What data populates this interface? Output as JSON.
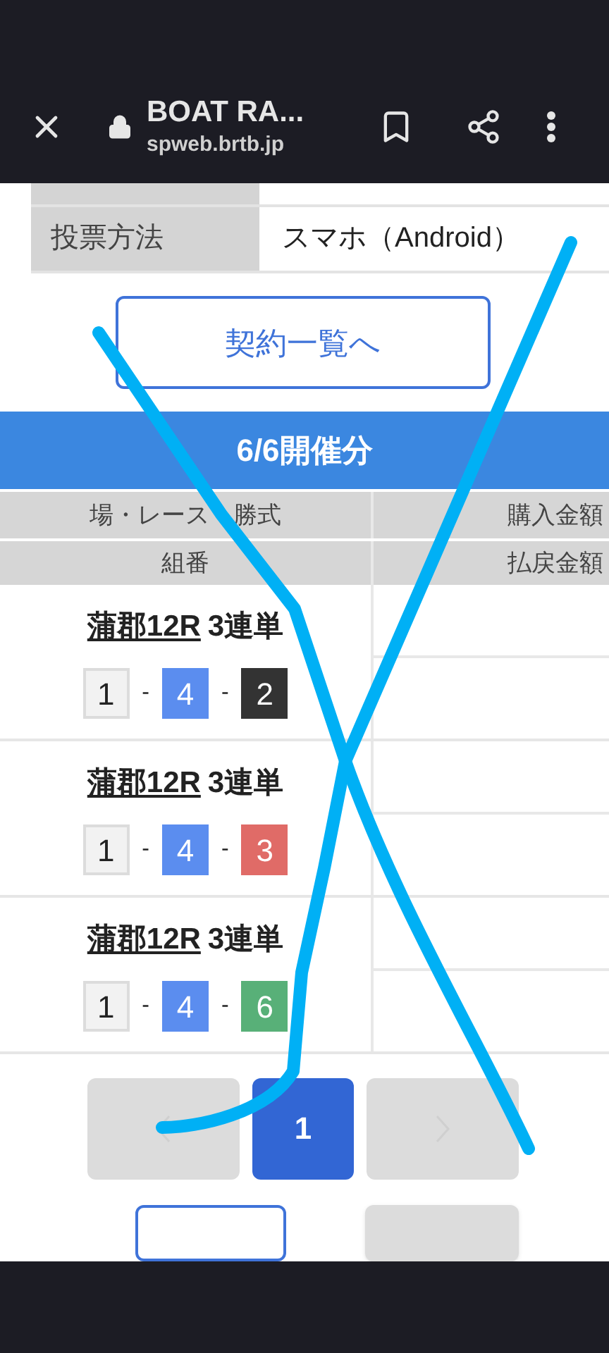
{
  "browser": {
    "title": "BOAT RA...",
    "url": "spweb.brtb.jp"
  },
  "info_rows": [
    {
      "label": "投票方法",
      "value": "スマホ（Android）"
    }
  ],
  "contract_button": "契約一覧へ",
  "section_title": "6/6開催分",
  "columns": {
    "left_top": "場・レース　勝式",
    "right_top": "購入金額",
    "left_bottom": "組番",
    "right_bottom": "払戻金額"
  },
  "bets": [
    {
      "race": "蒲郡12R",
      "bet_type": "3連単",
      "separator": "-",
      "numbers": [
        {
          "text": "1",
          "color": "#f2f2f2"
        },
        {
          "text": "4",
          "color": "#5b8def"
        },
        {
          "text": "2",
          "color": "#333333"
        }
      ]
    },
    {
      "race": "蒲郡12R",
      "bet_type": "3連単",
      "separator": "-",
      "numbers": [
        {
          "text": "1",
          "color": "#f2f2f2"
        },
        {
          "text": "4",
          "color": "#5b8def"
        },
        {
          "text": "3",
          "color": "#e06b67"
        }
      ]
    },
    {
      "race": "蒲郡12R",
      "bet_type": "3連単",
      "separator": "-",
      "numbers": [
        {
          "text": "1",
          "color": "#f2f2f2"
        },
        {
          "text": "4",
          "color": "#5b8def"
        },
        {
          "text": "6",
          "color": "#58b078"
        }
      ]
    }
  ],
  "pagination": {
    "previous": {
      "disabled": true
    },
    "pages": [
      {
        "label": "1",
        "selected": true
      }
    ],
    "next": {
      "disabled": true
    }
  }
}
